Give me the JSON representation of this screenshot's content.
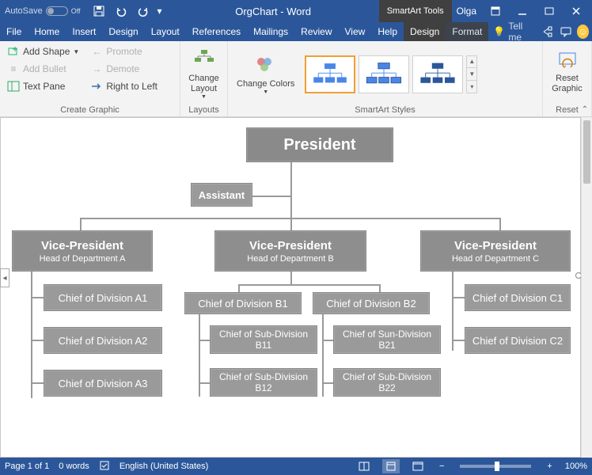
{
  "titlebar": {
    "autosave_label": "AutoSave",
    "autosave_state": "Off",
    "doc_title": "OrgChart - Word",
    "tools_label": "SmartArt Tools",
    "user_name": "Olga"
  },
  "tabs": {
    "file": "File",
    "home": "Home",
    "insert": "Insert",
    "design": "Design",
    "layout": "Layout",
    "references": "References",
    "mailings": "Mailings",
    "review": "Review",
    "view": "View",
    "help": "Help",
    "sa_design": "Design",
    "sa_format": "Format",
    "tellme": "Tell me"
  },
  "ribbon": {
    "create": {
      "add_shape": "Add Shape",
      "add_bullet": "Add Bullet",
      "text_pane": "Text Pane",
      "promote": "Promote",
      "demote": "Demote",
      "rtl": "Right to Left",
      "group": "Create Graphic"
    },
    "layouts": {
      "change_layout": "Change Layout",
      "group": "Layouts"
    },
    "colors": {
      "change_colors": "Change Colors"
    },
    "styles": {
      "group": "SmartArt Styles"
    },
    "reset": {
      "reset_graphic": "Reset Graphic",
      "group": "Reset"
    }
  },
  "org": {
    "president": "President",
    "assistant": "Assistant",
    "vp": [
      {
        "title": "Vice-President",
        "sub": "Head of Department A"
      },
      {
        "title": "Vice-President",
        "sub": "Head of Department B"
      },
      {
        "title": "Vice-President",
        "sub": "Head of Department C"
      }
    ],
    "a": [
      "Chief of Division A1",
      "Chief of Division A2",
      "Chief of Division A3"
    ],
    "b_top": [
      "Chief of Division B1",
      "Chief of Division B2"
    ],
    "b_sub": [
      "Chief of Sub-Division B11",
      "Chief of Sun-Division B21",
      "Chief of Sub-Division B12",
      "Chief of Sub-Division B22"
    ],
    "c": [
      "Chief of Division C1",
      "Chief of Division C2"
    ]
  },
  "status": {
    "page": "Page 1 of 1",
    "words": "0 words",
    "lang": "English (United States)",
    "zoom": "100%"
  }
}
